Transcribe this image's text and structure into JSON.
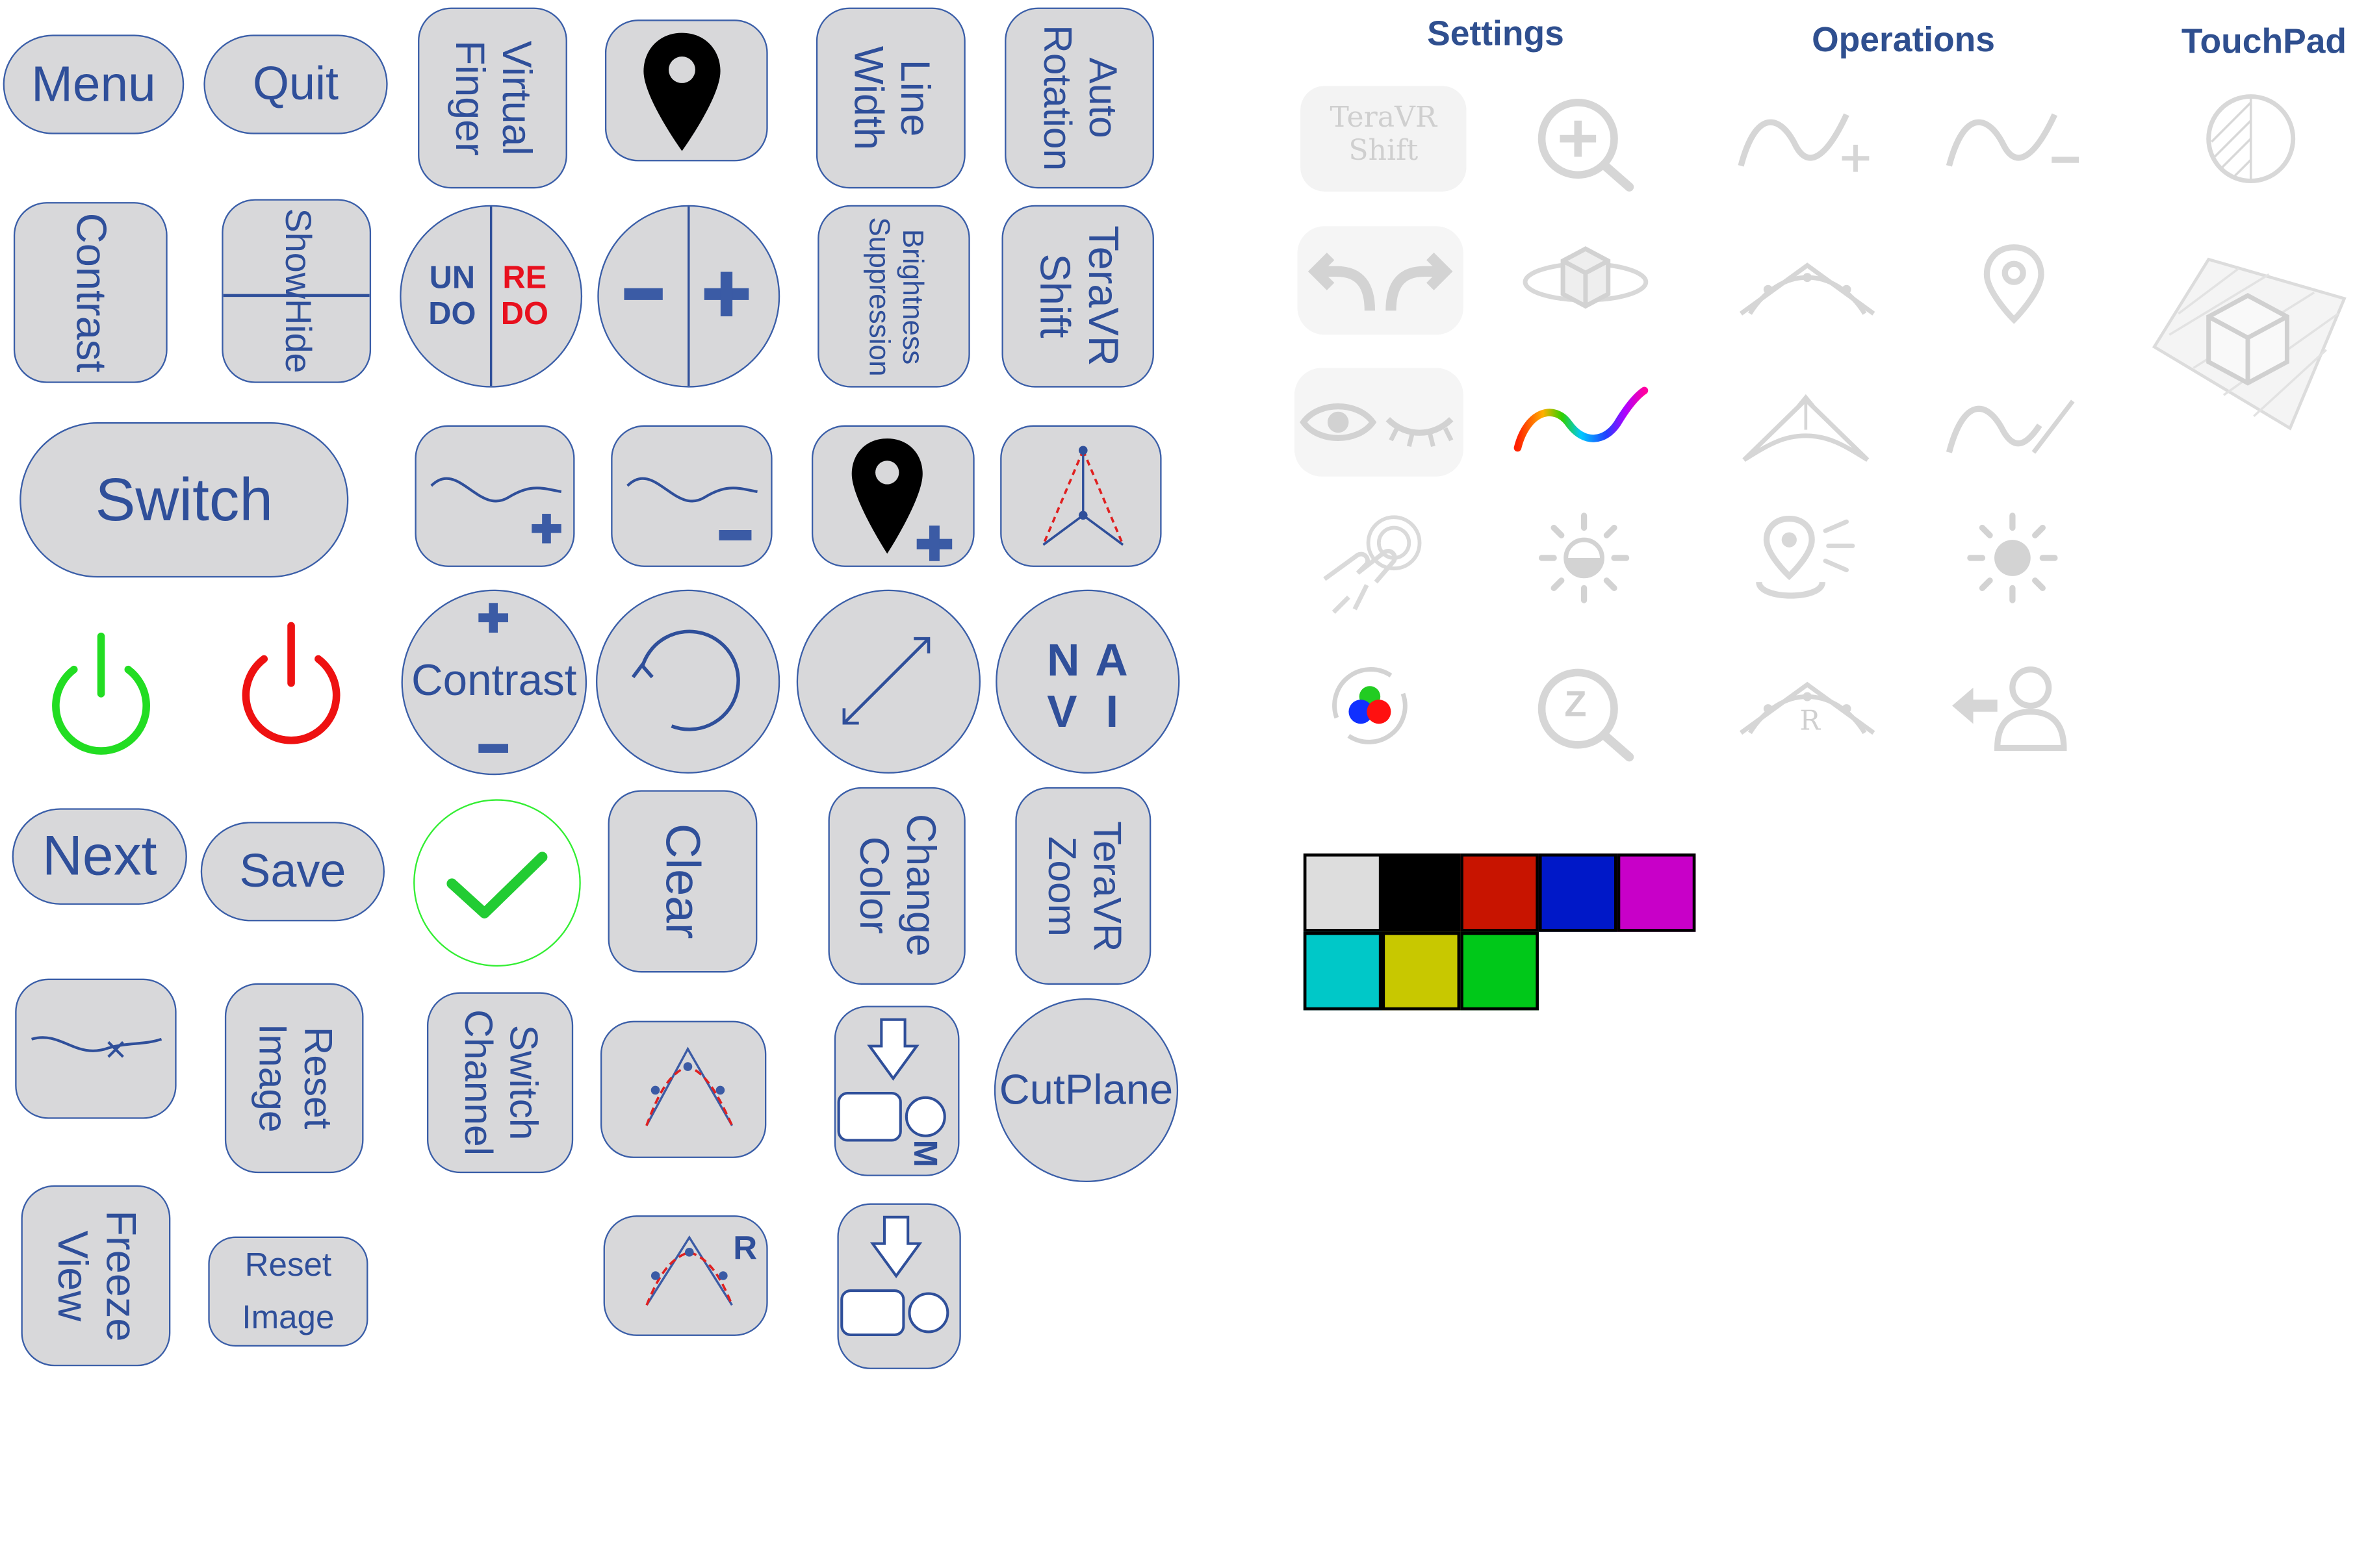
{
  "buttons": {
    "menu": "Menu",
    "quit": "Quit",
    "virtual_finger": [
      "Virtual",
      "Finger"
    ],
    "line_width": [
      "Line",
      "Width"
    ],
    "auto_rotation": [
      "Auto",
      "Rotation"
    ],
    "contrast": "Contrast",
    "show_hide": "ShowHide",
    "undo": [
      "UN",
      "DO"
    ],
    "redo": [
      "RE",
      "DO"
    ],
    "brightness_suppression": [
      "Brightness",
      "Suppression"
    ],
    "teravr_shift": [
      "TeraVR",
      "Shift"
    ],
    "switch": "Switch",
    "contrast_round": "Contrast",
    "navi": [
      "N",
      "A",
      "V",
      "I"
    ],
    "next": "Next",
    "save": "Save",
    "clear": "Clear",
    "change_color": [
      "Change",
      "Color"
    ],
    "teravr_zoom": [
      "TeraVR",
      "Zoom"
    ],
    "reset_image_rot": [
      "Reset",
      "Image"
    ],
    "switch_channel": [
      "Switch",
      "Channel"
    ],
    "m_label": "M",
    "cutplane": "CutPlane",
    "freeze_view": [
      "Freeze",
      "View"
    ],
    "reset_image": [
      "Reset",
      "Image"
    ],
    "r_label": "R"
  },
  "headers": {
    "settings": "Settings",
    "operations": "Operations",
    "touchpad": "TouchPad"
  },
  "ghost_icons": {
    "teravr_shift": [
      "TeraVR",
      "Shift"
    ],
    "z_label": "Z",
    "r_label": "R"
  },
  "palette": [
    "#dddddd",
    "#000000",
    "#c81400",
    "#0018c8",
    "#c800c8",
    "#00c8c8",
    "#c8c800",
    "#00c819"
  ],
  "colors": {
    "accent_blue": "#2f4f9a",
    "button_gray": "#d8d8da",
    "power_on": "#22dd22",
    "power_off": "#ee1111",
    "redo_red": "#e8101e",
    "ghost_gray": "#d9d9d9"
  }
}
